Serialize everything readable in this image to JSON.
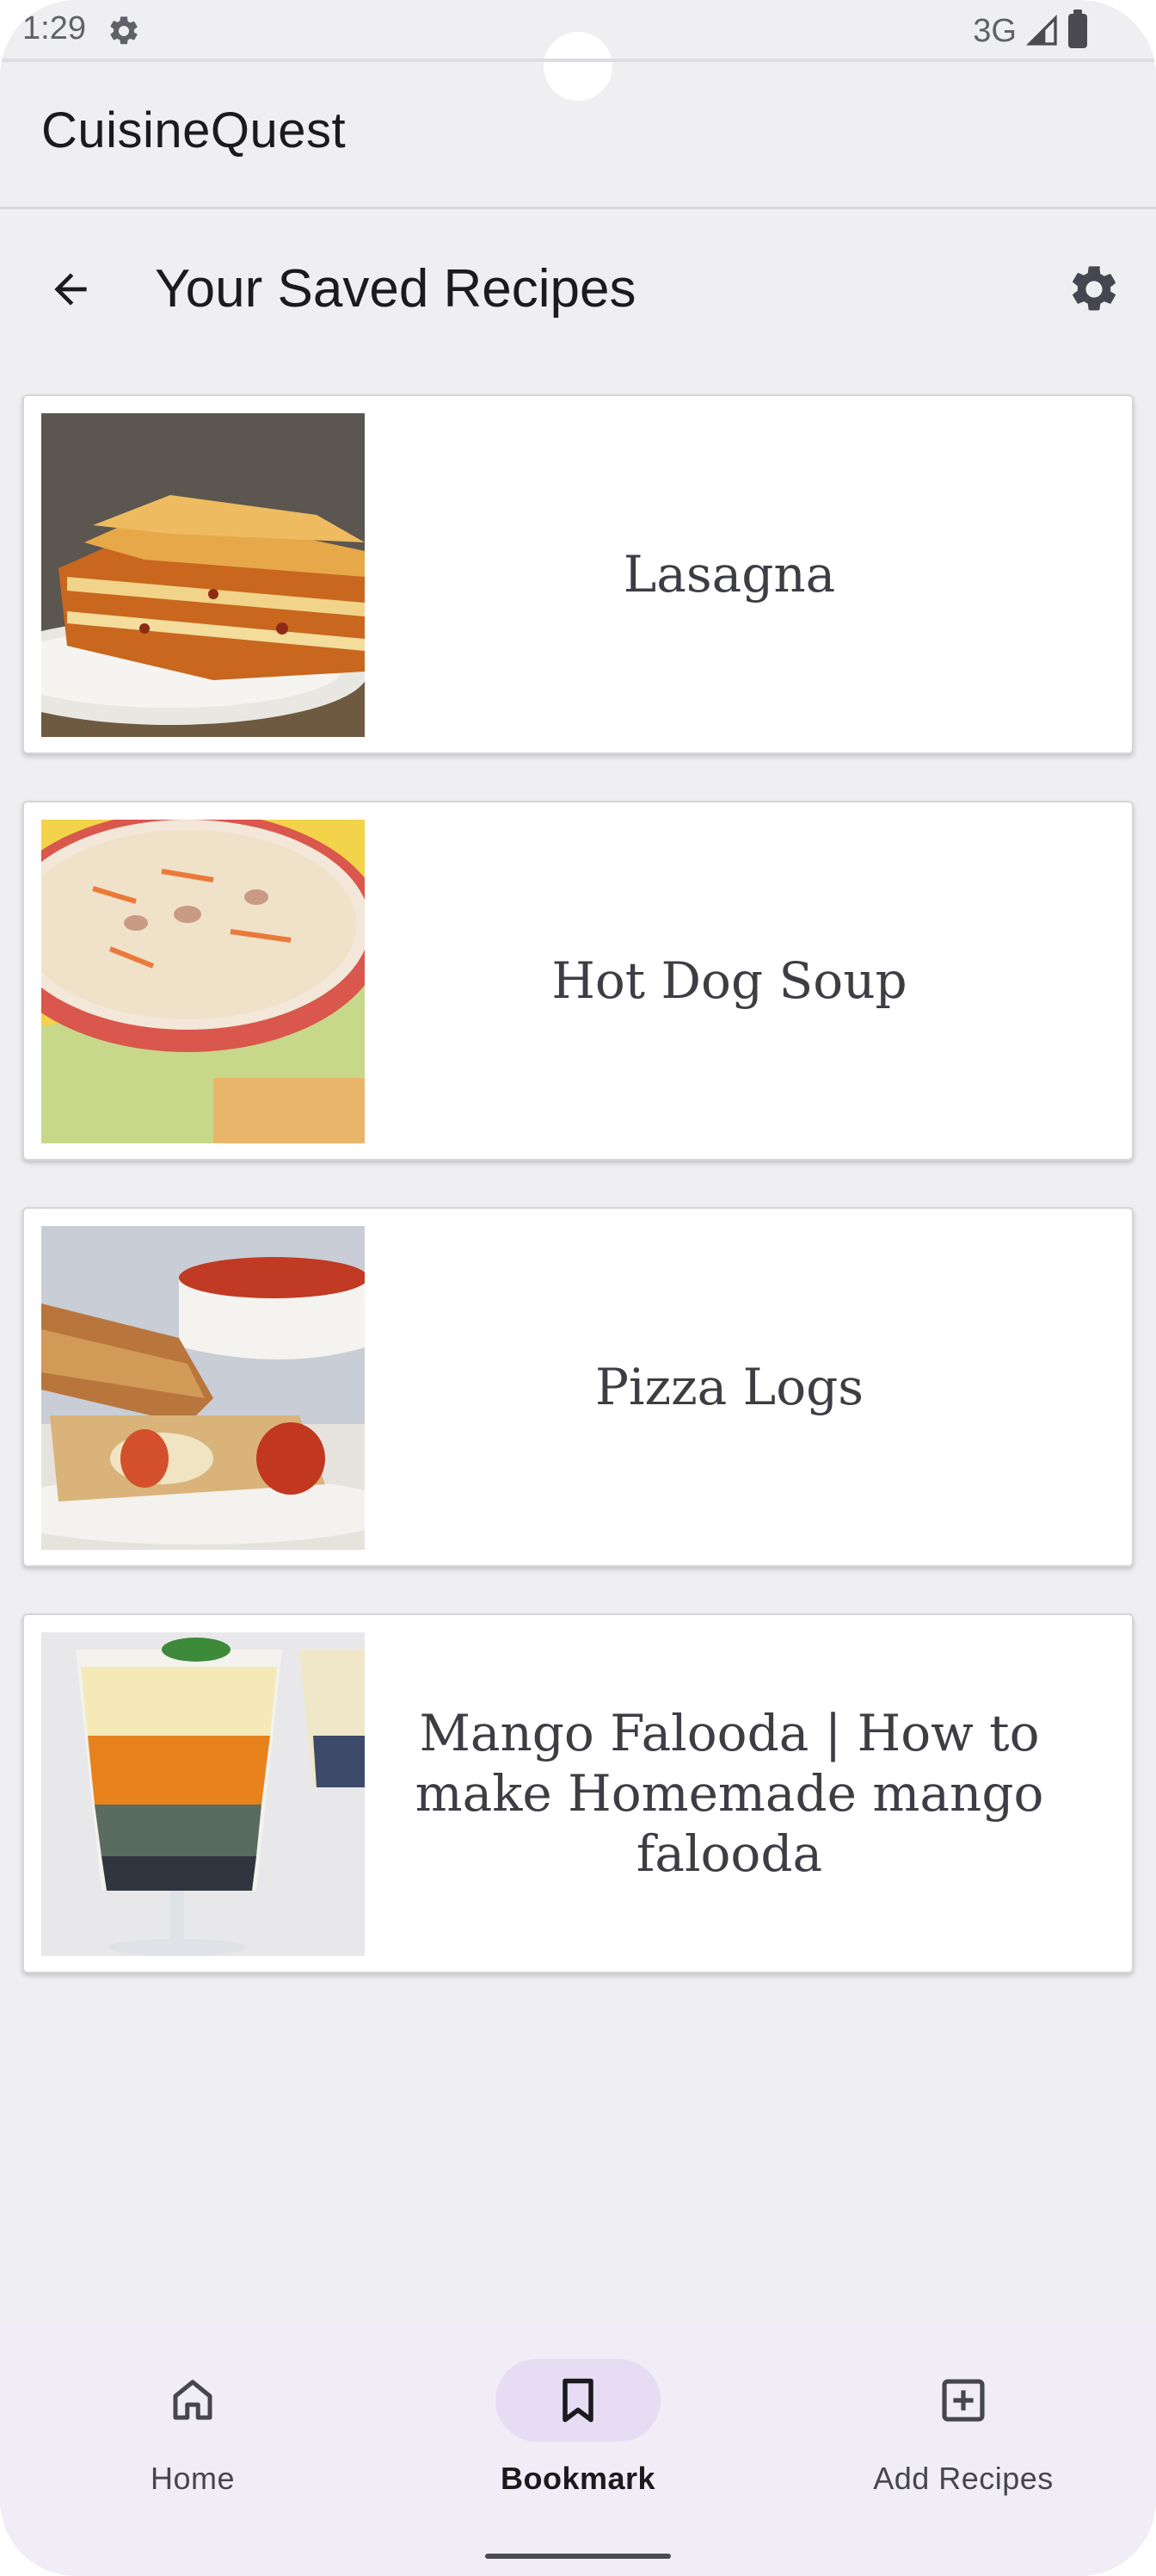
{
  "status_bar": {
    "time": "1:29",
    "network": "3G",
    "icons": [
      "gear-icon",
      "signal-icon",
      "battery-icon"
    ]
  },
  "app": {
    "title": "CuisineQuest"
  },
  "page": {
    "title": "Your Saved Recipes",
    "back_icon": "arrow-back-icon",
    "settings_icon": "gear-icon"
  },
  "recipes": [
    {
      "name": "Lasagna",
      "image": "lasagna-photo"
    },
    {
      "name": "Hot Dog Soup",
      "image": "hot-dog-soup-photo"
    },
    {
      "name": "Pizza Logs",
      "image": "pizza-logs-photo"
    },
    {
      "name": "Mango Falooda | How to make Homemade mango falooda",
      "image": "mango-falooda-photo"
    }
  ],
  "bottom_nav": {
    "items": [
      {
        "label": "Home",
        "icon": "home-icon",
        "active": false
      },
      {
        "label": "Bookmark",
        "icon": "bookmark-icon",
        "active": true
      },
      {
        "label": "Add Recipes",
        "icon": "add-box-icon",
        "active": false
      }
    ]
  },
  "colors": {
    "background": "#efeff2",
    "card": "#ffffff",
    "nav_background": "#f1edf6",
    "nav_active_indicator": "#e6ddf5",
    "recipe_text": "#3d3d44"
  }
}
